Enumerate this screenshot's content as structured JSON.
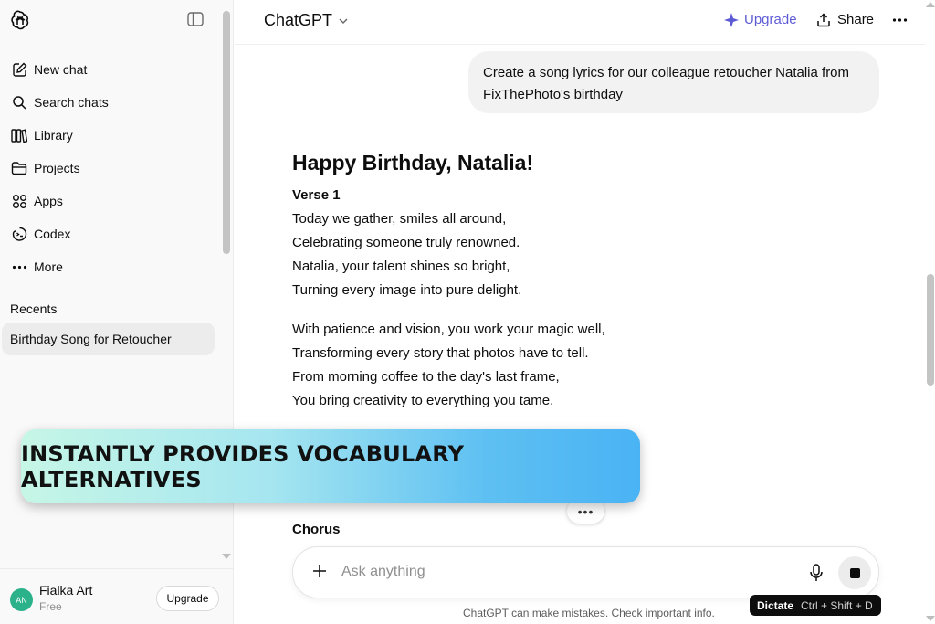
{
  "sidebar": {
    "nav": [
      {
        "label": "New chat",
        "icon": "pencil-square-icon"
      },
      {
        "label": "Search chats",
        "icon": "search-icon"
      },
      {
        "label": "Library",
        "icon": "library-icon"
      },
      {
        "label": "Projects",
        "icon": "folder-icon"
      },
      {
        "label": "Apps",
        "icon": "apps-grid-icon"
      },
      {
        "label": "Codex",
        "icon": "codex-icon"
      },
      {
        "label": "More",
        "icon": "ellipsis-icon"
      }
    ],
    "recents_title": "Recents",
    "recents": [
      "Birthday Song for Retoucher"
    ],
    "account": {
      "initials": "AN",
      "name": "Fialka Art",
      "plan": "Free",
      "upgrade_label": "Upgrade"
    }
  },
  "header": {
    "model": "ChatGPT",
    "upgrade_label": "Upgrade",
    "share_label": "Share"
  },
  "conversation": {
    "user_message": "Create a song lyrics for our colleague retoucher Natalia from FixThePhoto's birthday",
    "answer_title": "Happy Birthday, Natalia!",
    "verse_label": "Verse 1",
    "stanza1": [
      "Today we gather, smiles all around,",
      "Celebrating someone truly renowned.",
      "Natalia, your talent shines so bright,",
      "Turning every image into pure delight."
    ],
    "stanza2": [
      "With patience and vision, you work your magic well,",
      "Transforming every story that photos have to tell.",
      "From morning coffee to the day's last frame,",
      "You bring creativity to everything you tame."
    ],
    "chorus_label": "Chorus"
  },
  "composer": {
    "placeholder": "Ask anything",
    "disclaimer": "ChatGPT can make mistakes. Check important info.",
    "tooltip_label": "Dictate",
    "tooltip_shortcut": "Ctrl + Shift + D"
  },
  "banner": {
    "text": "INSTANTLY PROVIDES VOCABULARY ALTERNATIVES"
  },
  "colors": {
    "accent": "#5d5bd4",
    "avatar": "#2bb28a",
    "banner_start": "#c6f6e6",
    "banner_end": "#4ab3f4"
  }
}
